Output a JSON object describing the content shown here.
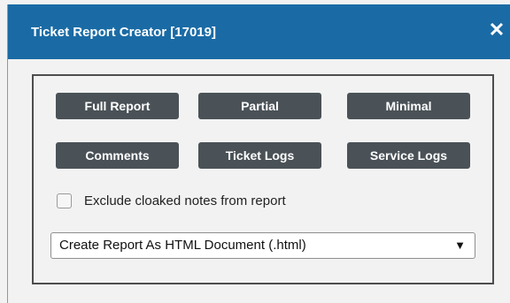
{
  "dialog": {
    "title": "Ticket Report Creator [17019]",
    "close_glyph": "✕"
  },
  "buttons": {
    "full_report": "Full Report",
    "partial": "Partial",
    "minimal": "Minimal",
    "comments": "Comments",
    "ticket_logs": "Ticket Logs",
    "service_logs": "Service Logs"
  },
  "options": {
    "exclude_cloaked_label": "Exclude cloaked notes from report",
    "exclude_cloaked_checked": false
  },
  "format_select": {
    "selected": "Create Report As HTML Document (.html)",
    "arrow_glyph": "▼"
  },
  "colors": {
    "titlebar": "#1a6ba5",
    "button": "#4a5257",
    "background": "#f2f2f2"
  }
}
